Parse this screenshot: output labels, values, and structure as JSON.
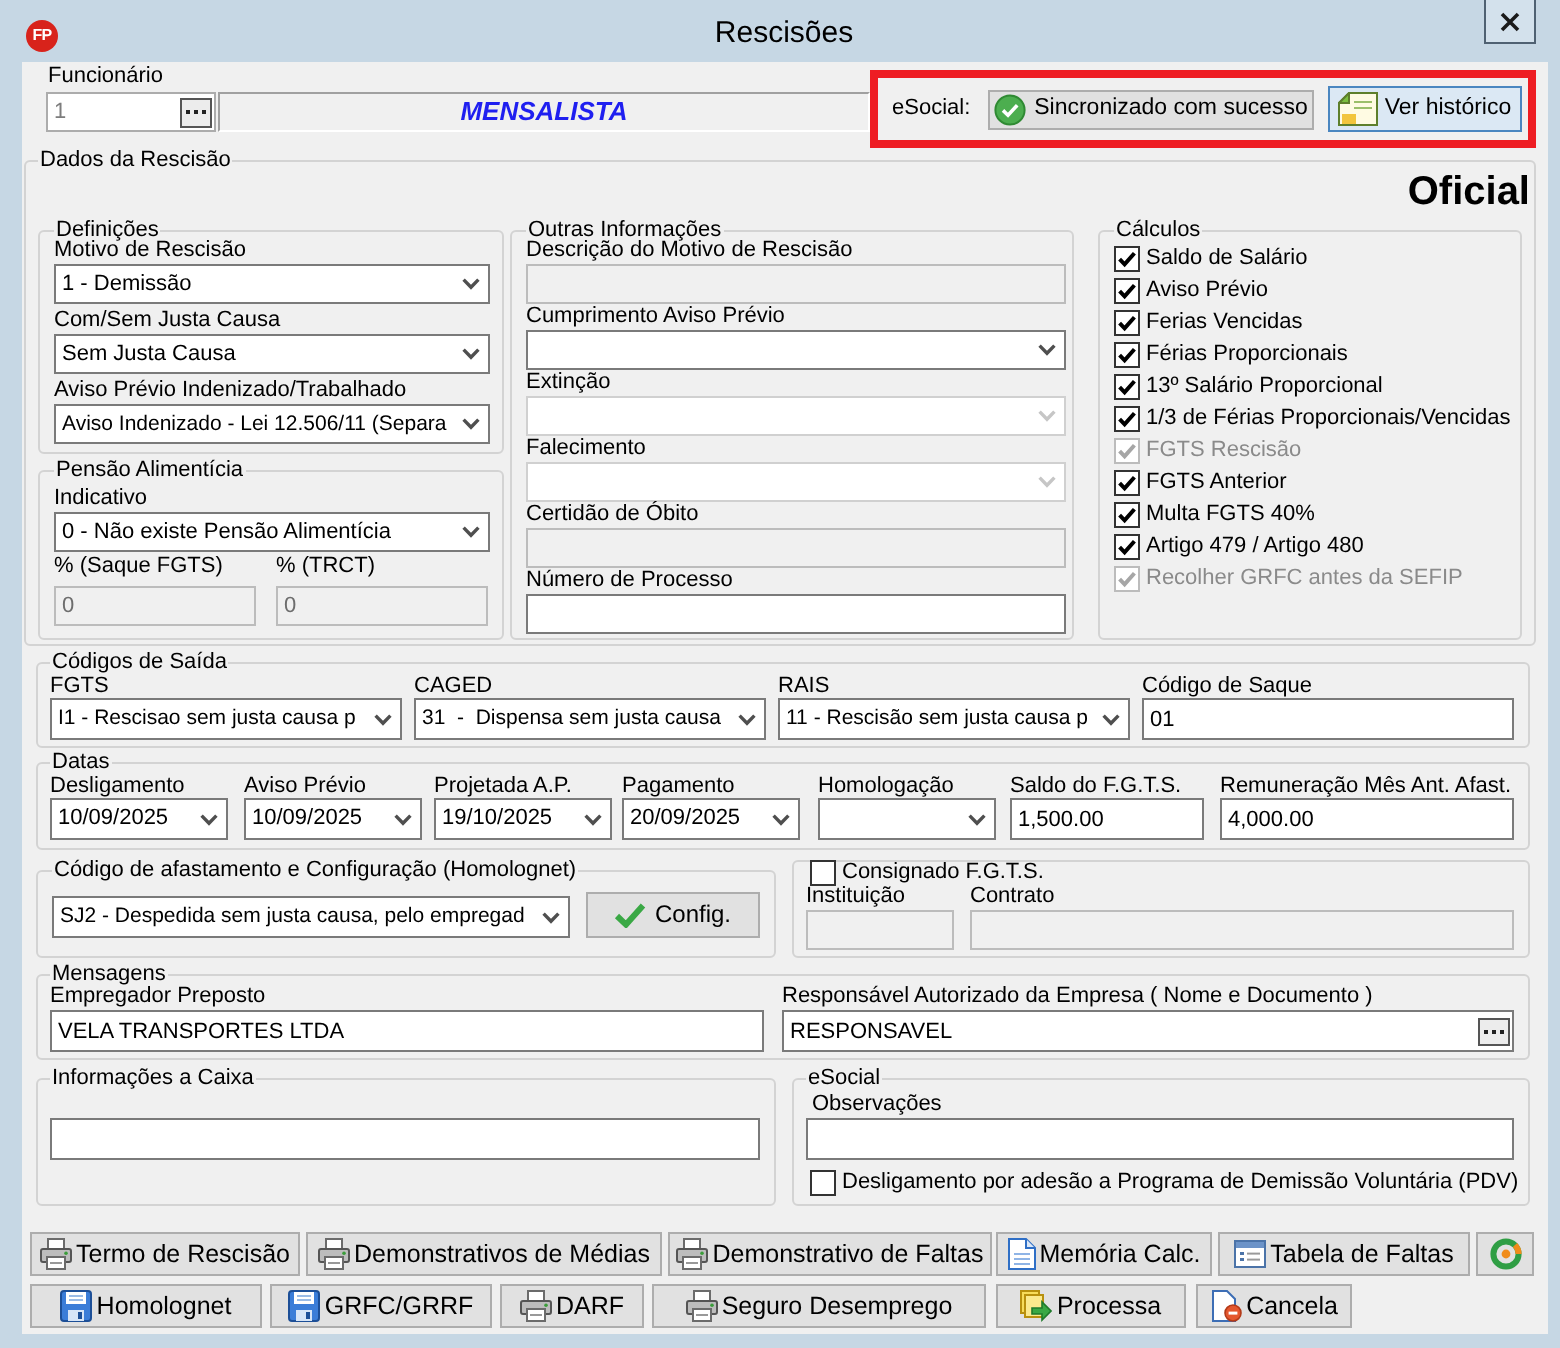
{
  "window": {
    "logo": "FP",
    "title": "Rescisões"
  },
  "employee": {
    "label": "Funcionário",
    "value": "1",
    "category": "MENSALISTA"
  },
  "esocial_status": {
    "label": "eSocial:",
    "status_button": "Sincronizado com sucesso",
    "history_button": "Ver histórico"
  },
  "dados_rescisao": {
    "title": "Dados da Rescisão",
    "badge": "Oficial",
    "definicoes": {
      "title": "Definições",
      "fields": [
        {
          "label": "Motivo de Rescisão",
          "value": "1 - Demissão"
        },
        {
          "label": "Com/Sem Justa Causa",
          "value": "Sem Justa Causa"
        },
        {
          "label": "Aviso Prévio Indenizado/Trabalhado",
          "value": "Aviso Indenizado - Lei 12.506/11 (Separa"
        }
      ]
    },
    "pensao": {
      "title": "Pensão Alimentícia",
      "indicativo": {
        "label": "Indicativo",
        "value": "0 - Não existe Pensão Alimentícia"
      },
      "percentages": [
        {
          "label": "% (Saque FGTS)",
          "value": "0",
          "disabled": true
        },
        {
          "label": "% (TRCT)",
          "value": "0",
          "disabled": true
        }
      ]
    },
    "outras": {
      "title": "Outras Informações",
      "fields": [
        {
          "label": "Descrição do Motivo de Rescisão",
          "kind": "text",
          "disabled": true
        },
        {
          "label": "Cumprimento Aviso Prévio",
          "kind": "dropdown",
          "disabled": false
        },
        {
          "label": "Extinção",
          "kind": "dropdown",
          "disabled": true
        },
        {
          "label": "Falecimento",
          "kind": "dropdown",
          "disabled": true
        },
        {
          "label": "Certidão de Óbito",
          "kind": "text",
          "disabled": true
        },
        {
          "label": "Número de Processo",
          "kind": "text",
          "disabled": false
        }
      ]
    },
    "calculos": {
      "title": "Cálculos",
      "items": [
        {
          "label": "Saldo de Salário",
          "checked": true,
          "disabled": false
        },
        {
          "label": "Aviso Prévio",
          "checked": true,
          "disabled": false
        },
        {
          "label": "Ferias Vencidas",
          "checked": true,
          "disabled": false
        },
        {
          "label": "Férias Proporcionais",
          "checked": true,
          "disabled": false
        },
        {
          "label": "13º Salário Proporcional",
          "checked": true,
          "disabled": false
        },
        {
          "label": "1/3 de Férias Proporcionais/Vencidas",
          "checked": true,
          "disabled": false
        },
        {
          "label": "FGTS Rescisão",
          "checked": true,
          "disabled": true
        },
        {
          "label": "FGTS Anterior",
          "checked": true,
          "disabled": false
        },
        {
          "label": "Multa FGTS 40%",
          "checked": true,
          "disabled": false
        },
        {
          "label": "Artigo 479 / Artigo 480",
          "checked": true,
          "disabled": false
        },
        {
          "label": "Recolher GRFC antes da SEFIP",
          "checked": true,
          "disabled": true
        }
      ]
    }
  },
  "codigos_saida": {
    "title": "Códigos de Saída",
    "fields": [
      {
        "label": "FGTS",
        "value": "I1 - Rescisao sem justa causa p",
        "kind": "dropdown"
      },
      {
        "label": "CAGED",
        "value": "31  -  Dispensa sem justa causa",
        "kind": "dropdown"
      },
      {
        "label": "RAIS",
        "value": "11 - Rescisão sem justa causa p",
        "kind": "dropdown"
      },
      {
        "label": "Código de Saque",
        "value": "01",
        "kind": "text"
      }
    ]
  },
  "datas": {
    "title": "Datas",
    "fields": [
      {
        "label": "Desligamento",
        "value": "10/09/2025",
        "kind": "dropdown"
      },
      {
        "label": "Aviso Prévio",
        "value": "10/09/2025",
        "kind": "dropdown"
      },
      {
        "label": "Projetada A.P.",
        "value": "19/10/2025",
        "kind": "dropdown"
      },
      {
        "label": "Pagamento",
        "value": "20/09/2025",
        "kind": "dropdown"
      },
      {
        "label": "Homologação",
        "kind": "dropdown"
      },
      {
        "label": "Saldo do F.G.T.S.",
        "value": "1,500.00",
        "kind": "text"
      },
      {
        "label": "Remuneração Mês Ant. Afast.",
        "value": "4,000.00",
        "kind": "text"
      }
    ]
  },
  "homolognet": {
    "title": "Código de afastamento e Configuração (Homolognet)",
    "value": "SJ2 - Despedida sem justa causa, pelo empregad",
    "button": "Config."
  },
  "consignado": {
    "label": "Consignado F.G.T.S.",
    "checked": false,
    "fields": [
      {
        "label": "Instituição",
        "disabled": true
      },
      {
        "label": "Contrato",
        "disabled": true
      }
    ]
  },
  "mensagens": {
    "title": "Mensagens",
    "fields": [
      {
        "label": "Empregador Preposto",
        "value": "VELA TRANSPORTES LTDA",
        "kind": "text"
      },
      {
        "label": "Responsável Autorizado da Empresa ( Nome e Documento )",
        "value": "RESPONSAVEL",
        "kind": "browse"
      }
    ]
  },
  "informacoes_caixa": {
    "title": "Informações a Caixa"
  },
  "esocial": {
    "title": "eSocial",
    "observacoes": {
      "label": "Observações"
    },
    "pdv": {
      "label": "Desligamento por adesão a Programa de Demissão Voluntária (PDV)",
      "checked": false
    }
  },
  "buttons": [
    [
      {
        "label": "Termo de Rescisão",
        "kind": "print"
      },
      {
        "label": "Demonstrativos de Médias",
        "kind": "print"
      },
      {
        "label": "Demonstrativo de Faltas",
        "kind": "print"
      },
      {
        "label": "Memória Calc.",
        "kind": "memo"
      },
      {
        "label": "Tabela de Faltas",
        "kind": "table"
      },
      {
        "kind": "sync"
      }
    ],
    [
      {
        "label": "Homolognet",
        "kind": "save"
      },
      {
        "label": "GRFC/GRRF",
        "kind": "save"
      },
      {
        "label": "DARF",
        "kind": "print"
      },
      {
        "label": "Seguro Desemprego",
        "kind": "print"
      },
      {
        "label": "Processa",
        "kind": "process"
      },
      {
        "label": "Cancela",
        "kind": "cancel"
      }
    ]
  ]
}
